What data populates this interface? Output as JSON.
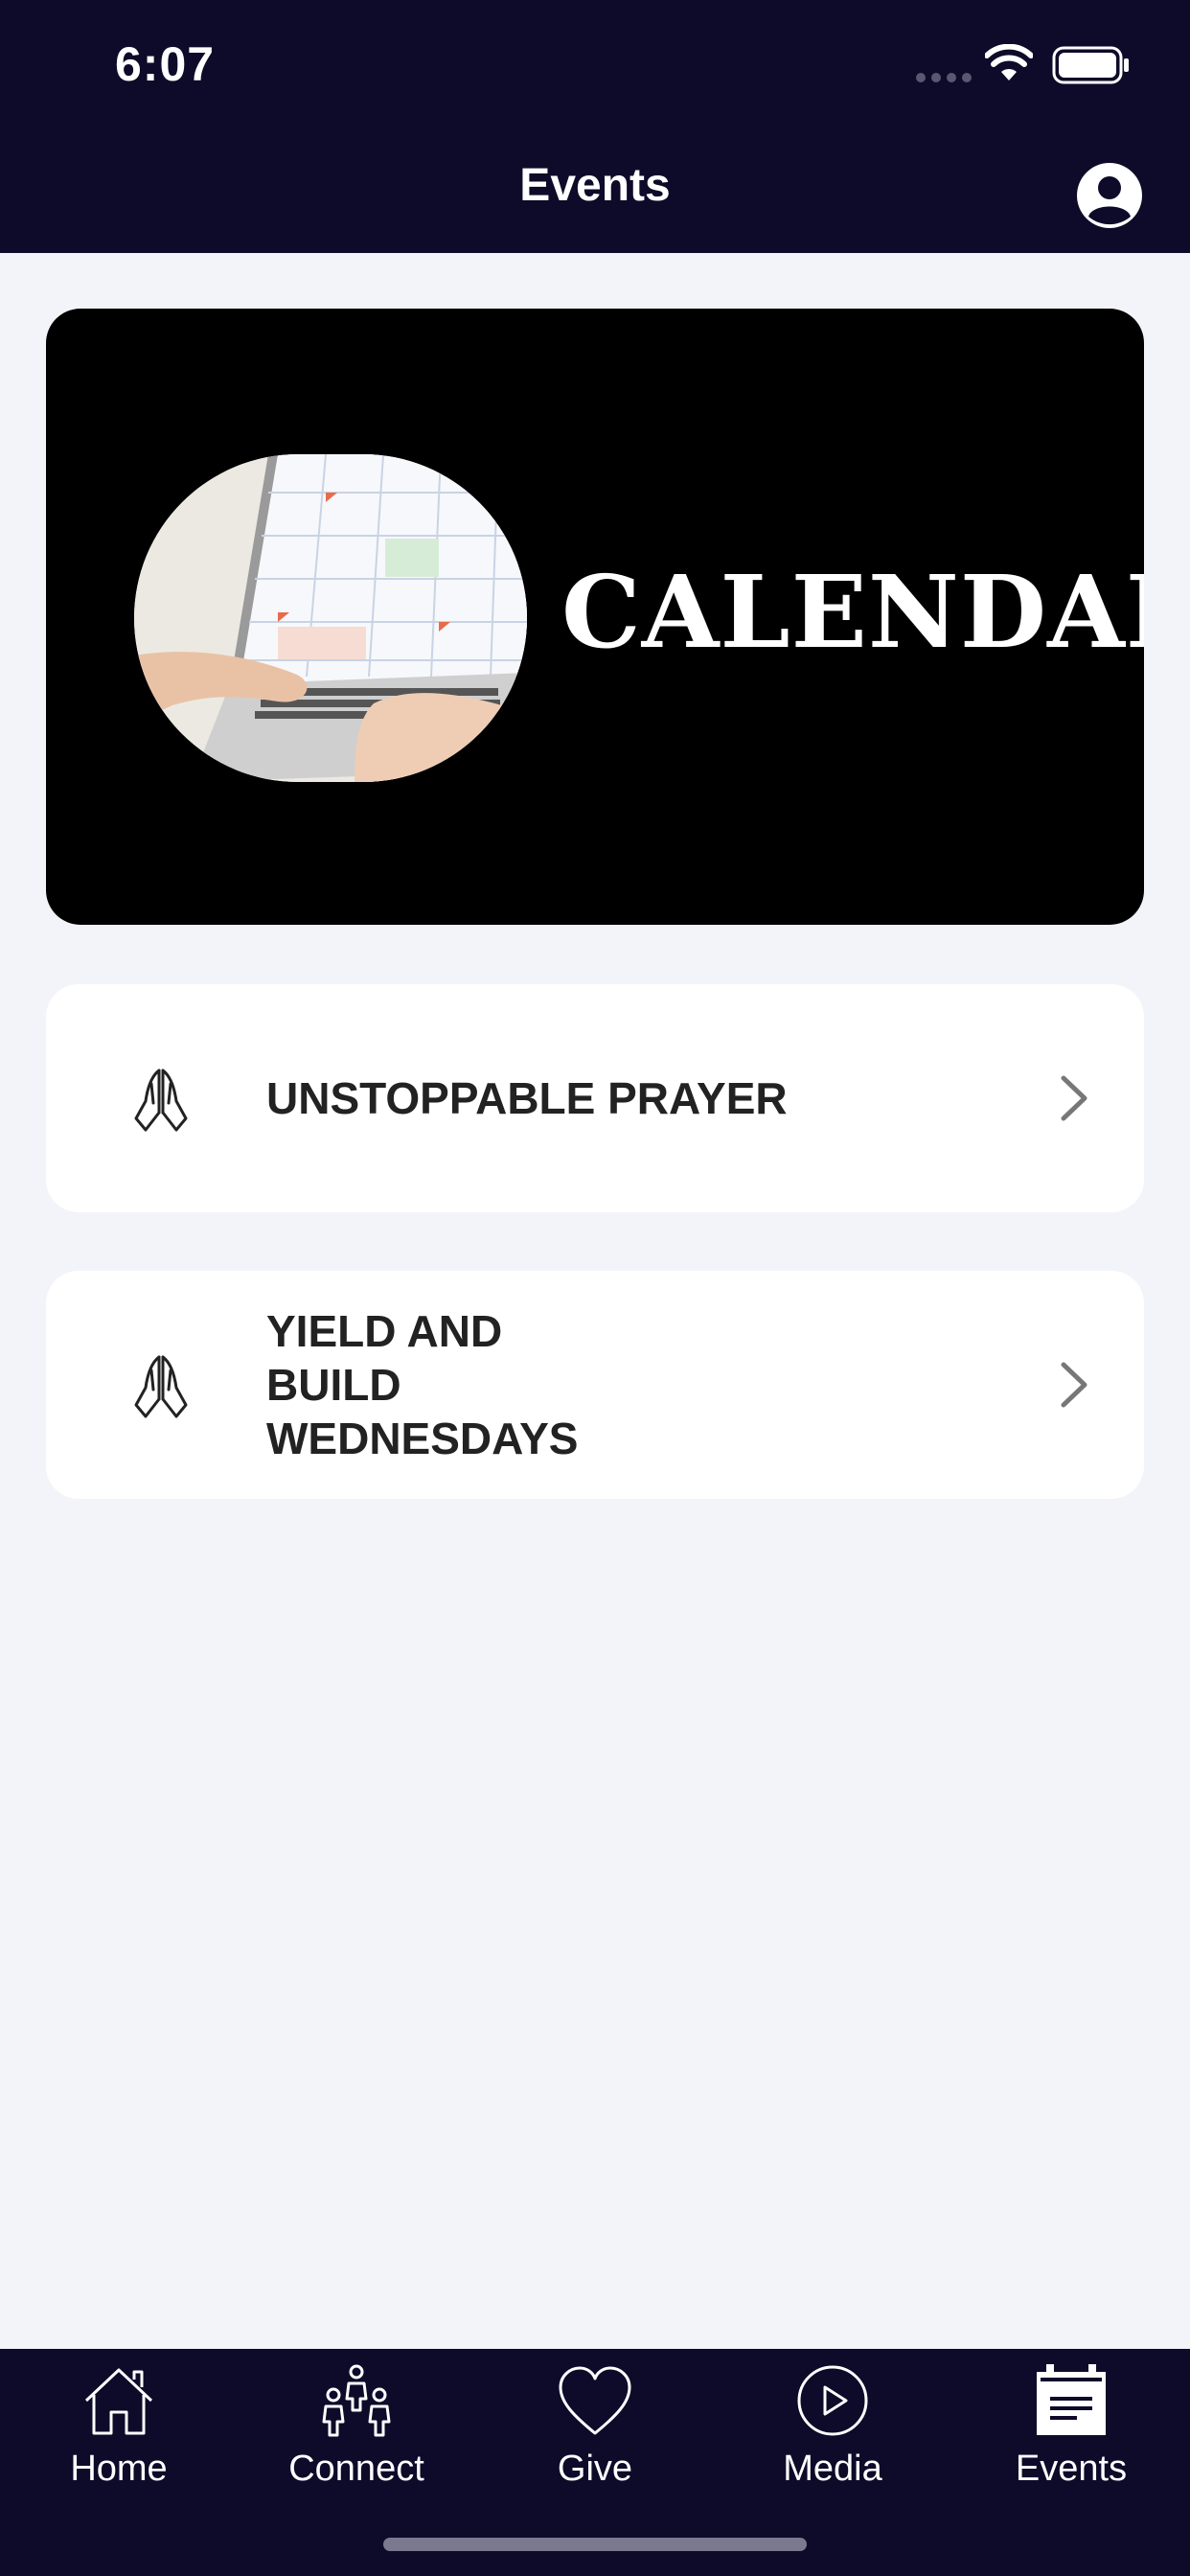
{
  "status_bar": {
    "time": "6:07"
  },
  "header": {
    "title": "Events"
  },
  "banner": {
    "title": "CALENDAR"
  },
  "events": [
    {
      "label": "UNSTOPPABLE PRAYER",
      "icon": "praying-hands-icon"
    },
    {
      "label": "YIELD AND BUILD WEDNESDAYS",
      "icon": "praying-hands-icon"
    }
  ],
  "tabbar": {
    "items": [
      {
        "label": "Home",
        "icon": "home-icon"
      },
      {
        "label": "Connect",
        "icon": "people-icon"
      },
      {
        "label": "Give",
        "icon": "heart-icon"
      },
      {
        "label": "Media",
        "icon": "play-circle-icon"
      },
      {
        "label": "Events",
        "icon": "calendar-icon",
        "active": true
      }
    ]
  },
  "colors": {
    "header_bg": "#0e0a29",
    "page_bg": "#f3f4f9",
    "card_bg": "#ffffff",
    "text_dark": "#222222"
  }
}
